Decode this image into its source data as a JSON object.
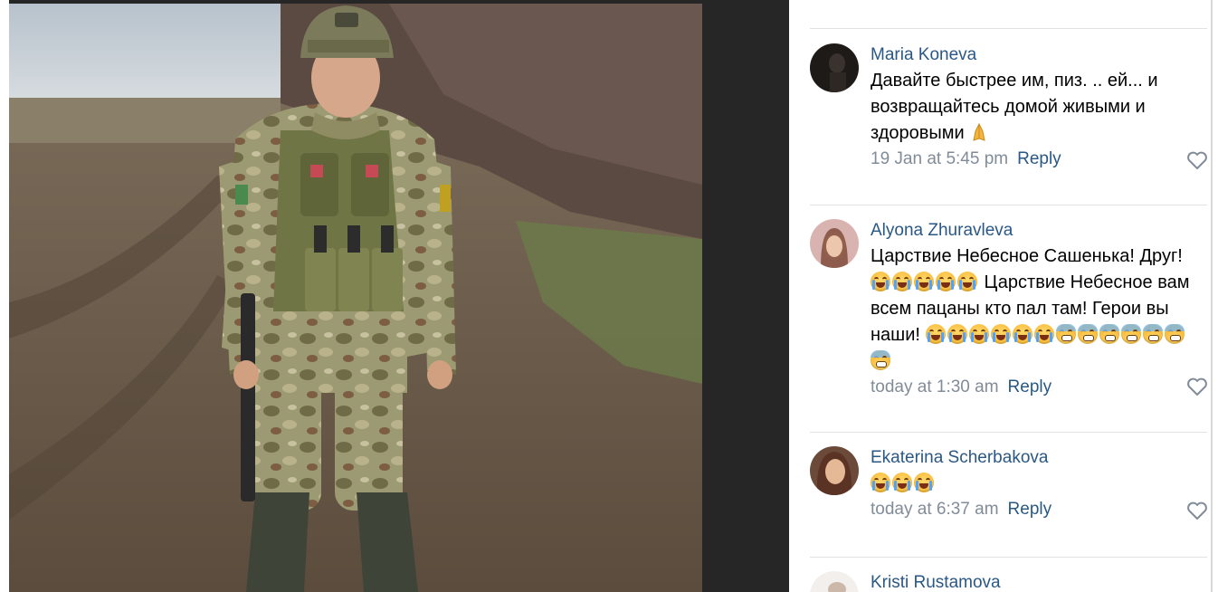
{
  "post": {
    "photo_icon": "photo-soldier-in-field"
  },
  "comments": [
    {
      "author": "Maria Koneva",
      "text_parts": [
        "Давайте быстрее им, пиз. .. ей... и возвращайтесь домой живыми и здоровыми "
      ],
      "emoji": [
        "folded-hands"
      ],
      "time": "19 Jan at 5:45 pm",
      "reply": "Reply"
    },
    {
      "author": "Alyona Zhuravleva",
      "text_line1": "Царствие Небесное Сашенька! Друг! ",
      "text_line2": " Царствие Небесное вам всем пацаны кто пал там! Герои вы наши! ",
      "emoji": [
        "loudly-crying-face",
        "loudly-crying-face",
        "loudly-crying-face",
        "loudly-crying-face",
        "loudly-crying-face",
        "loudly-crying-face",
        "loudly-crying-face",
        "loudly-crying-face",
        "loudly-crying-face",
        "loudly-crying-face",
        "loudly-crying-face",
        "fearful-face",
        "fearful-face",
        "fearful-face",
        "fearful-face",
        "fearful-face",
        "fearful-face",
        "fearful-face"
      ],
      "time": "today at 1:30 am",
      "reply": "Reply"
    },
    {
      "author": "Ekaterina Scherbakova",
      "emoji": [
        "loudly-crying-face",
        "loudly-crying-face",
        "loudly-crying-face"
      ],
      "time": "today at 6:37 am",
      "reply": "Reply"
    },
    {
      "author": "Kristi Rustamova"
    }
  ],
  "icons": {
    "like": "heart-outline-icon"
  },
  "colors": {
    "author": "#2a5885",
    "meta": "#818c99",
    "viewer_bg": "#262626"
  }
}
